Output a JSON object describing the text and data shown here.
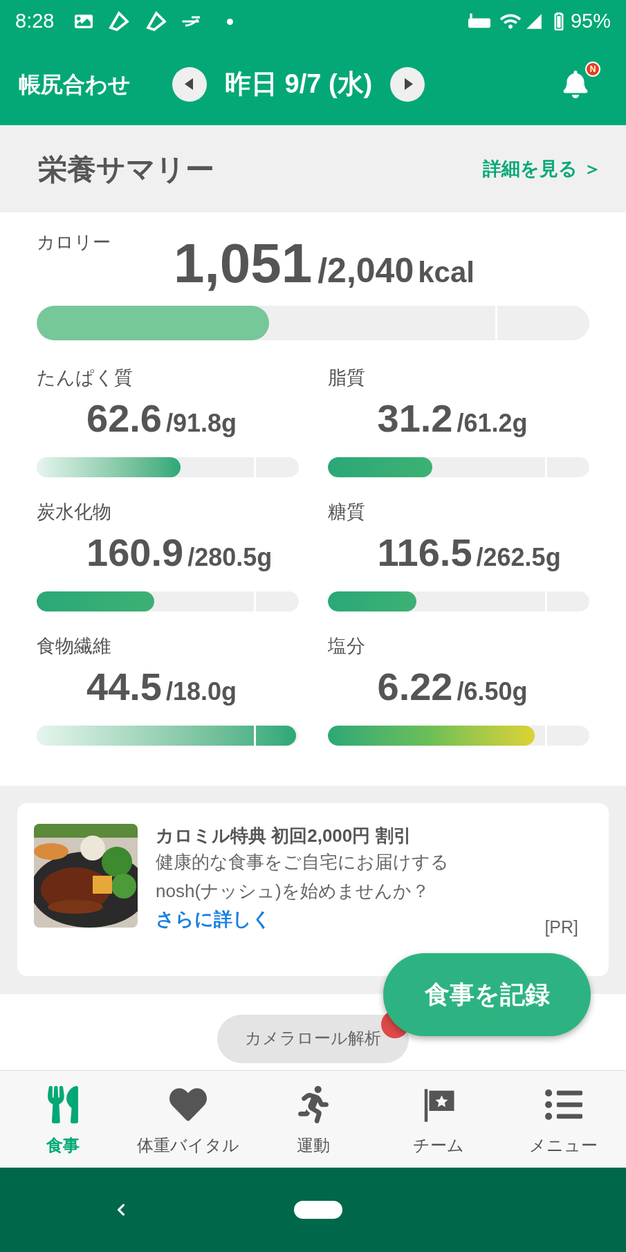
{
  "status_bar": {
    "time": "8:28",
    "battery": "95%"
  },
  "header": {
    "title": "帳尻合わせ",
    "date": "昨日 9/7 (水)",
    "notification_badge": "N"
  },
  "summary": {
    "title": "栄養サマリー",
    "details_link": "詳細を見る ＞"
  },
  "calories": {
    "label": "カロリー",
    "value": "1,051",
    "target": "/2,040",
    "unit": "kcal",
    "level": 0.42
  },
  "nutrients": [
    {
      "label": "たんぱく質",
      "value": "62.6",
      "target": "/91.8g",
      "level": 0.55,
      "kind": "fade"
    },
    {
      "label": "脂質",
      "value": "31.2",
      "target": "/61.2g",
      "level": 0.4,
      "kind": "solid"
    },
    {
      "label": "炭水化物",
      "value": "160.9",
      "target": "/280.5g",
      "level": 0.45,
      "kind": "solid"
    },
    {
      "label": "糖質",
      "value": "116.5",
      "target": "/262.5g",
      "level": 0.34,
      "kind": "solid"
    },
    {
      "label": "食物繊維",
      "value": "44.5",
      "target": "/18.0g",
      "level": 0.99,
      "kind": "fade"
    },
    {
      "label": "塩分",
      "value": "6.22",
      "target": "/6.50g",
      "level": 0.79,
      "kind": "warn"
    }
  ],
  "ad": {
    "title": "カロミル特典 初回2,000円 割引",
    "lines": [
      "健康的な食事をご自宅にお届けする",
      "nosh(ナッシュ)を始めませんか？"
    ],
    "link": "さらに詳しく",
    "tag": "[PR]"
  },
  "camera_chip": "カメラロール解析",
  "fab": "食事を記録",
  "bottom_nav": [
    {
      "label": "食事",
      "selected": true
    },
    {
      "label": "体重バイタル",
      "selected": false
    },
    {
      "label": "運動",
      "selected": false
    },
    {
      "label": "チーム",
      "selected": false
    },
    {
      "label": "メニュー",
      "selected": false
    }
  ]
}
